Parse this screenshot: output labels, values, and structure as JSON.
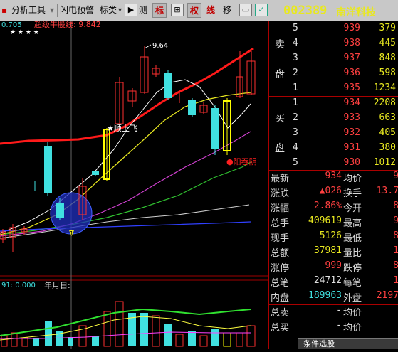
{
  "toolbar": {
    "left_stub": "▪",
    "analysis_tool": "分析工具",
    "flash_alert": "闪电预警",
    "indicator": "标类",
    "measure": "测",
    "label_btn": "标",
    "crosshair_btn": "⊞",
    "rights_btn": "权",
    "line_btn": "线",
    "move_btn": "移",
    "mark_btn": "✓"
  },
  "stock": {
    "code": "002389",
    "name": "南洋科技"
  },
  "chart": {
    "top_label_left": "0.705",
    "top_label": "超级牛股线: 9.842",
    "top_label_stars": "★ ★ ★ ★",
    "high_marker": "9.64",
    "signal_buy": "★顺上飞",
    "signal_sell": "●阳吞阴",
    "dot_marker": "1",
    "volume_label": "91: 0.000",
    "date_label": "年月日:"
  },
  "orderbook": {
    "sell_label": [
      "卖",
      "盘"
    ],
    "buy_label": [
      "买",
      "盘"
    ],
    "sell": [
      {
        "level": "5",
        "price": "939",
        "volume": "379"
      },
      {
        "level": "4",
        "price": "938",
        "volume": "445"
      },
      {
        "level": "3",
        "price": "937",
        "volume": "848"
      },
      {
        "level": "2",
        "price": "936",
        "volume": "598"
      },
      {
        "level": "1",
        "price": "935",
        "volume": "1234"
      }
    ],
    "buy": [
      {
        "level": "1",
        "price": "934",
        "volume": "2208"
      },
      {
        "level": "2",
        "price": "933",
        "volume": "663"
      },
      {
        "level": "3",
        "price": "932",
        "volume": "405"
      },
      {
        "level": "4",
        "price": "931",
        "volume": "380"
      },
      {
        "level": "5",
        "price": "930",
        "volume": "1012"
      }
    ]
  },
  "stats": [
    {
      "k1": "最新",
      "v1": "934",
      "c1": "red",
      "k2": "均价",
      "v2": "9"
    },
    {
      "k1": "涨跌",
      "v1": "▲026",
      "c1": "red",
      "k2": "换手",
      "v2": "13.7"
    },
    {
      "k1": "涨幅",
      "v1": "2.86%",
      "c1": "red",
      "k2": "今开",
      "v2": "8"
    },
    {
      "k1": "总手",
      "v1": "409619",
      "c1": "yel",
      "k2": "最高",
      "v2": "9"
    },
    {
      "k1": "现手",
      "v1": "5126",
      "c1": "yel",
      "k2": "最低",
      "v2": "8"
    },
    {
      "k1": "总额",
      "v1": "37981",
      "c1": "yel",
      "k2": "量比",
      "v2": "1"
    },
    {
      "k1": "涨停",
      "v1": "999",
      "c1": "red",
      "k2": "跌停",
      "v2": "8"
    },
    {
      "k1": "总笔",
      "v1": "24712",
      "c1": "wht",
      "k2": "每笔",
      "v2": "1"
    },
    {
      "k1": "内盘",
      "v1": "189963",
      "c1": "cyan",
      "k2": "外盘",
      "v2": "2197"
    },
    {
      "k1": "总卖",
      "v1": "-",
      "c1": "wht",
      "k2": "均价",
      "v2": ""
    },
    {
      "k1": "总买",
      "v1": "-",
      "c1": "wht",
      "k2": "均价",
      "v2": ""
    }
  ],
  "bottom_tab": "条件选股",
  "colors": {
    "up": "#ff3030",
    "down": "#40e0e0",
    "signal": "#ffff00",
    "ma_long": "#ff2020"
  }
}
